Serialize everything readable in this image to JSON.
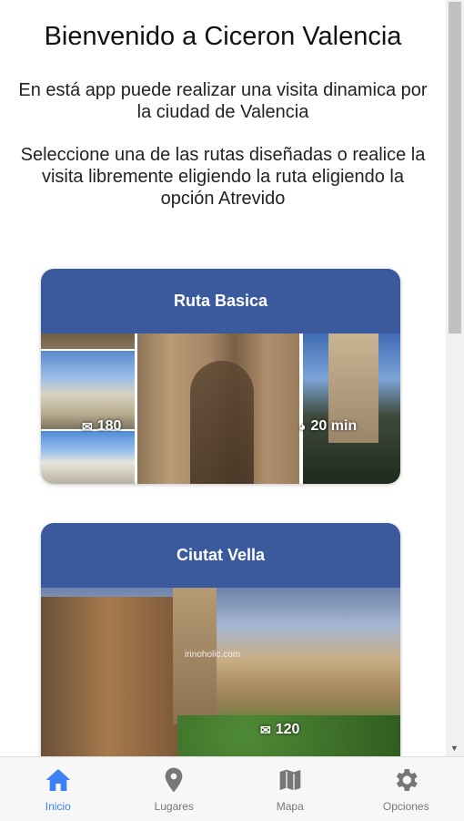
{
  "header": {
    "title": "Bienvenido a Ciceron Valencia",
    "intro1": "En está app puede realizar una visita dinamica por la ciudad de Valencia",
    "intro2": "Seleccione una de las rutas diseñadas o realice la visita libremente eligiendo la ruta eligiendo la opción Atrevido"
  },
  "routes": [
    {
      "title": "Ruta Basica",
      "stops": "180",
      "duration": "20 min"
    },
    {
      "title": "Ciutat Vella",
      "stops": "120",
      "watermark": "irinoholic.com"
    }
  ],
  "nav": [
    {
      "label": "Inicio",
      "icon": "home-icon",
      "active": true
    },
    {
      "label": "Lugares",
      "icon": "map-pin-icon",
      "active": false
    },
    {
      "label": "Mapa",
      "icon": "map-icon",
      "active": false
    },
    {
      "label": "Opciones",
      "icon": "gear-icon",
      "active": false
    }
  ],
  "colors": {
    "accent": "#3b5a9d",
    "nav_active": "#3b82f6",
    "nav_inactive": "#777777"
  }
}
